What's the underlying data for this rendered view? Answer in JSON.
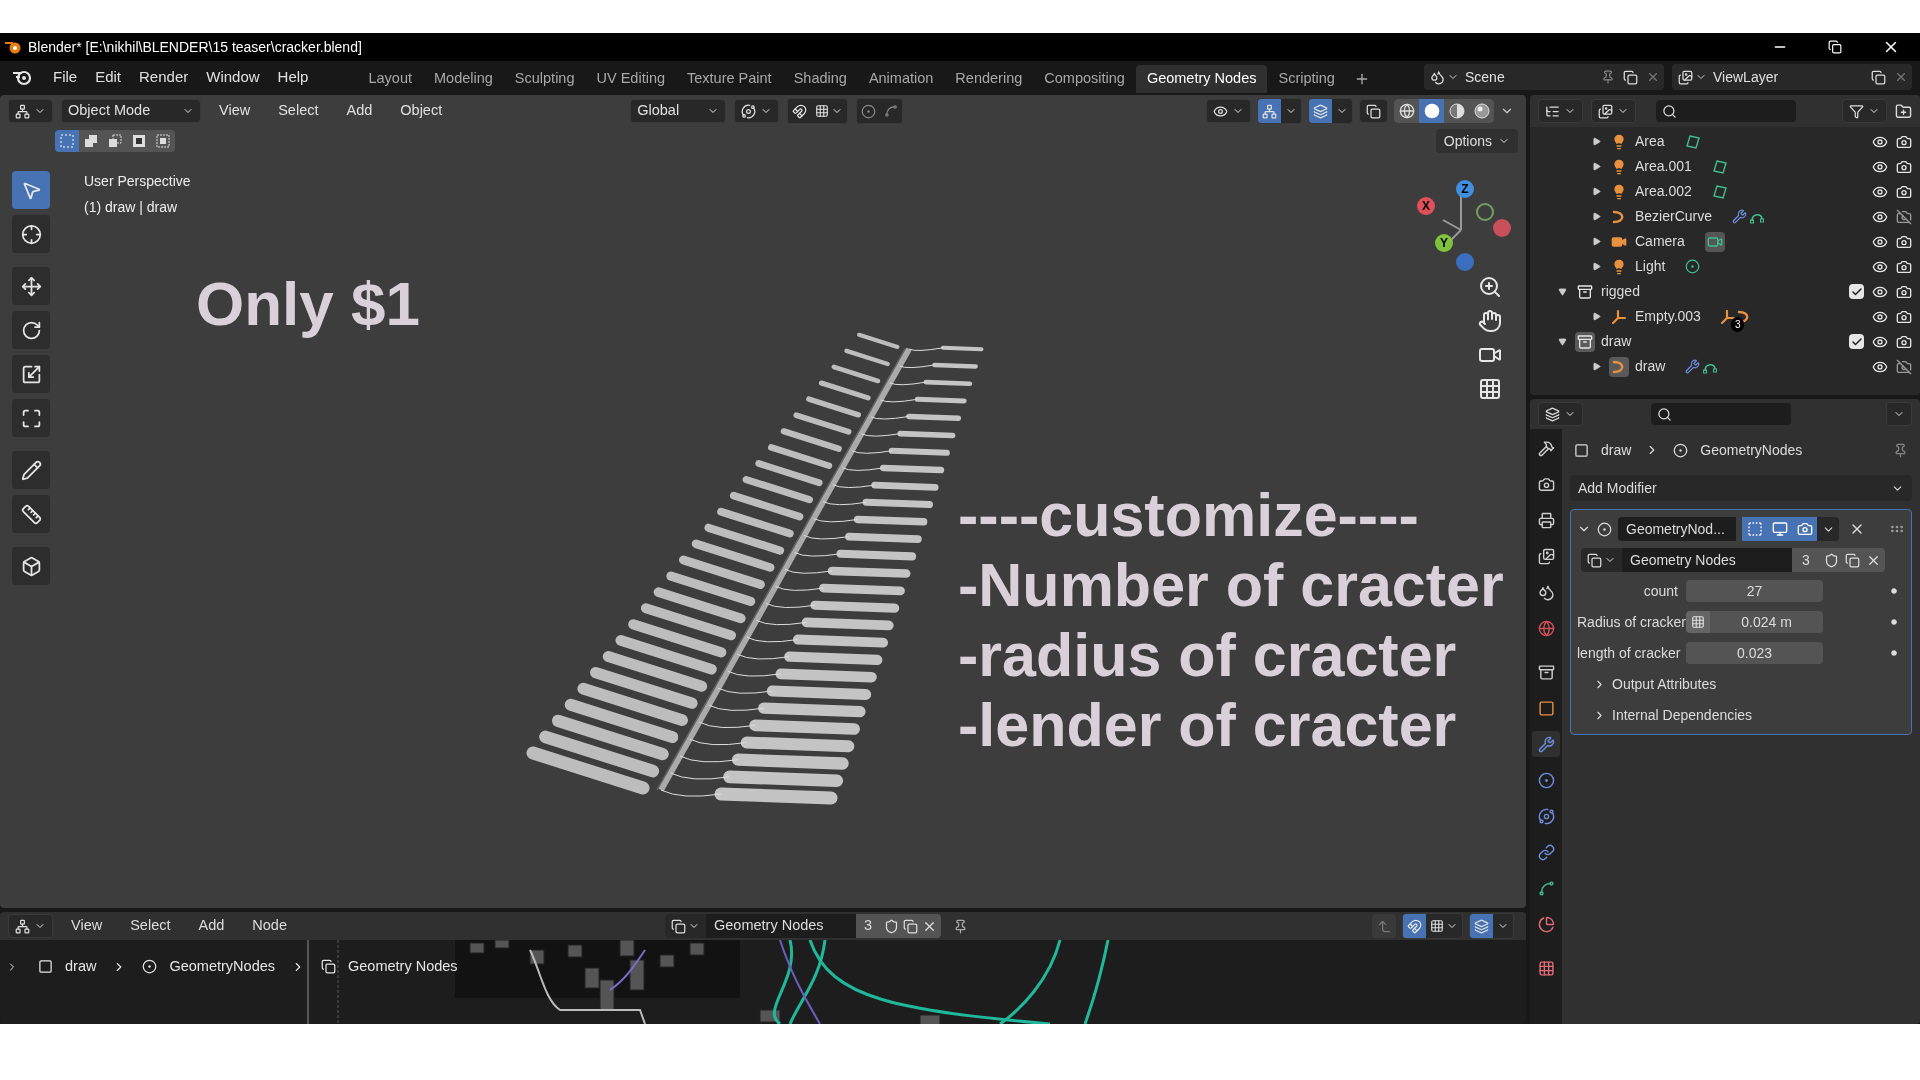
{
  "window": {
    "title": "Blender* [E:\\nikhil\\BLENDER\\15 teaser\\cracker.blend]"
  },
  "menu": [
    "File",
    "Edit",
    "Render",
    "Window",
    "Help"
  ],
  "workspaces": [
    {
      "label": "Layout",
      "selected": false
    },
    {
      "label": "Modeling",
      "selected": false
    },
    {
      "label": "Sculpting",
      "selected": false
    },
    {
      "label": "UV Editing",
      "selected": false
    },
    {
      "label": "Texture Paint",
      "selected": false
    },
    {
      "label": "Shading",
      "selected": false
    },
    {
      "label": "Animation",
      "selected": false
    },
    {
      "label": "Rendering",
      "selected": false
    },
    {
      "label": "Compositing",
      "selected": false
    },
    {
      "label": "Geometry Nodes",
      "selected": true
    },
    {
      "label": "Scripting",
      "selected": false
    }
  ],
  "scene": "Scene",
  "view_layer": "ViewLayer",
  "viewport": {
    "mode": "Object Mode",
    "menus": [
      "View",
      "Select",
      "Add",
      "Object"
    ],
    "orientation": "Global",
    "options": "Options",
    "toggles": [
      {
        "kind": "snap",
        "on": false
      },
      {
        "kind": "proportional",
        "on": false
      },
      {
        "kind": "gizmo",
        "on": true
      },
      {
        "kind": "overlay",
        "on": true
      }
    ],
    "select_modes": [
      {
        "kind": "set",
        "selected": true
      },
      {
        "kind": "extend",
        "selected": false
      },
      {
        "kind": "subtract",
        "selected": false
      },
      {
        "kind": "difference",
        "selected": false
      },
      {
        "kind": "intersect",
        "selected": false
      }
    ],
    "shading": [
      {
        "kind": "wireframe",
        "selected": false
      },
      {
        "kind": "solid",
        "selected": true
      },
      {
        "kind": "material",
        "selected": false
      },
      {
        "kind": "rendered",
        "selected": false
      }
    ],
    "tools": [
      {
        "kind": "select",
        "selected": true
      },
      {
        "kind": "cursor",
        "selected": false
      },
      {
        "kind": "move",
        "selected": false
      },
      {
        "kind": "rotate",
        "selected": false
      },
      {
        "kind": "scale",
        "selected": false
      },
      {
        "kind": "transform",
        "selected": false
      },
      {
        "kind": "annotate",
        "selected": false
      },
      {
        "kind": "measure",
        "selected": false
      },
      {
        "kind": "add_cube",
        "selected": false
      }
    ],
    "overlay_lines": [
      "User Perspective",
      "(1) draw | draw"
    ],
    "axes": [
      "X",
      "Y",
      "Z"
    ],
    "captions": [
      "Only $1",
      "----customize----",
      "-Number of cracter",
      "-radius of cracter",
      "-lender of cracter"
    ]
  },
  "outliner": {
    "rows_above": [
      {
        "name": "Area",
        "kind": "light",
        "active": false,
        "renderable": true,
        "data_icons": [
          {
            "kind": "area"
          }
        ]
      },
      {
        "name": "Area.001",
        "kind": "light",
        "active": false,
        "renderable": true,
        "data_icons": [
          {
            "kind": "area"
          }
        ]
      },
      {
        "name": "Area.002",
        "kind": "light",
        "active": false,
        "renderable": true,
        "data_icons": [
          {
            "kind": "area"
          }
        ]
      },
      {
        "name": "BezierCurve",
        "kind": "curve",
        "active": false,
        "renderable": false,
        "data_icons": [
          {
            "kind": "modifier"
          },
          {
            "kind": "curve"
          }
        ]
      },
      {
        "name": "Camera",
        "kind": "camera",
        "active": false,
        "renderable": true,
        "data_icons": [
          {
            "kind": "camera"
          }
        ]
      },
      {
        "name": "Light",
        "kind": "light",
        "active": false,
        "renderable": true,
        "data_icons": [
          {
            "kind": "point"
          }
        ]
      }
    ],
    "collections": [
      {
        "name": "rigged",
        "expanded": true,
        "checked": true,
        "active": false,
        "children": [
          {
            "name": "Empty.003",
            "kind": "empty",
            "active": false,
            "renderable": true,
            "data_icons": [
              {
                "kind": "empty"
              },
              {
                "kind": "object_curve"
              }
            ],
            "child_count": "3"
          }
        ]
      },
      {
        "name": "draw",
        "expanded": true,
        "checked": true,
        "active": true,
        "children": [
          {
            "name": "draw",
            "kind": "curve",
            "active": true,
            "renderable": false,
            "data_icons": [
              {
                "kind": "modifier"
              },
              {
                "kind": "curve"
              }
            ]
          }
        ]
      }
    ]
  },
  "properties": {
    "tabs": [
      {
        "kind": "tool",
        "selected": false
      },
      {
        "kind": "render",
        "selected": false
      },
      {
        "kind": "output",
        "selected": false
      },
      {
        "kind": "view_layer",
        "selected": false
      },
      {
        "kind": "scene",
        "selected": false
      },
      {
        "kind": "world",
        "selected": false
      },
      {
        "kind": "collection",
        "selected": false
      },
      {
        "kind": "object",
        "selected": false
      },
      {
        "kind": "modifiers",
        "selected": true
      },
      {
        "kind": "particles",
        "selected": false
      },
      {
        "kind": "physics",
        "selected": false
      },
      {
        "kind": "constraints",
        "selected": false
      },
      {
        "kind": "data",
        "selected": false
      },
      {
        "kind": "material",
        "selected": false
      },
      {
        "kind": "texture",
        "selected": false
      }
    ],
    "breadcrumb": [
      "draw",
      "GeometryNodes"
    ],
    "add_modifier": "Add Modifier",
    "modifier": {
      "name": "GeometryNod...",
      "expanded": true,
      "toggles": [
        {
          "kind": "editmode",
          "on": true
        },
        {
          "kind": "viewport",
          "on": true
        },
        {
          "kind": "render",
          "on": true
        }
      ],
      "node_group": "Geometry Nodes",
      "users": "3",
      "inputs": [
        {
          "label": "count",
          "value": "27",
          "kind": "plain"
        },
        {
          "label": "Radius of cracker",
          "value": "0.024 m",
          "kind": "attribute"
        },
        {
          "label": "length of cracker",
          "value": "0.023",
          "kind": "plain"
        }
      ],
      "subpanels": [
        {
          "label": "Output Attributes",
          "expanded": false
        },
        {
          "label": "Internal Dependencies",
          "expanded": false
        }
      ]
    }
  },
  "node_editor": {
    "menus": [
      "View",
      "Select",
      "Add",
      "Node"
    ],
    "node_group": "Geometry Nodes",
    "users": "3",
    "breadcrumb": [
      "draw",
      "GeometryNodes",
      "Geometry Nodes"
    ],
    "toggles": [
      {
        "kind": "snap",
        "on": true
      },
      {
        "kind": "overlay",
        "on": true
      }
    ]
  }
}
